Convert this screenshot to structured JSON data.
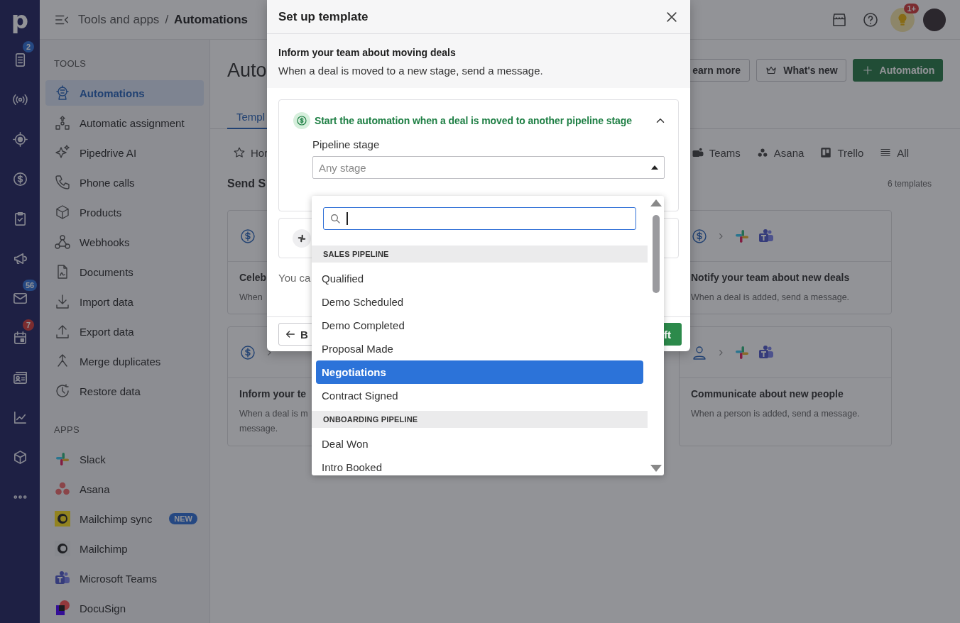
{
  "rail": {
    "logo": "p",
    "badges": [
      {
        "count": "2",
        "color": "#264882"
      },
      {
        "count": "56",
        "color": "#264882"
      },
      {
        "count": "7",
        "color": "#7b2d30"
      }
    ]
  },
  "topbar": {
    "parent": "Tools and apps",
    "separator": "/",
    "current": "Automations",
    "notification_badge": "1+"
  },
  "sidebar": {
    "sections": [
      {
        "title": "TOOLS",
        "items": [
          {
            "label": "Automations",
            "selected": true
          },
          {
            "label": "Automatic assignment",
            "selected": false
          },
          {
            "label": "Pipedrive AI",
            "selected": false
          },
          {
            "label": "Phone calls",
            "selected": false
          },
          {
            "label": "Products",
            "selected": false
          },
          {
            "label": "Webhooks",
            "selected": false
          },
          {
            "label": "Documents",
            "selected": false
          },
          {
            "label": "Import data",
            "selected": false
          },
          {
            "label": "Export data",
            "selected": false
          },
          {
            "label": "Merge duplicates",
            "selected": false
          },
          {
            "label": "Restore data",
            "selected": false
          }
        ]
      },
      {
        "title": "APPS",
        "items": [
          {
            "label": "Slack",
            "selected": false
          },
          {
            "label": "Asana",
            "selected": false
          },
          {
            "label": "Mailchimp sync",
            "selected": false,
            "badge": "NEW"
          },
          {
            "label": "Mailchimp",
            "selected": false
          },
          {
            "label": "Microsoft Teams",
            "selected": false
          },
          {
            "label": "DocuSign",
            "selected": false
          }
        ]
      }
    ]
  },
  "page": {
    "title": "Auto",
    "buttons": [
      {
        "label": "earn more",
        "kind": "outline"
      },
      {
        "label": "What's new",
        "kind": "crown"
      },
      {
        "label": "Automation",
        "kind": "primary"
      }
    ],
    "tabs": [
      {
        "label": "Templ",
        "selected": true
      }
    ],
    "filters_left": [
      "Hor"
    ],
    "filters_right": [
      "Teams",
      "Asana",
      "Trello",
      "All"
    ],
    "section_title": "Send S",
    "count": "6 templates",
    "cards": [
      {
        "kind": "template",
        "title": "Celeb",
        "description_lines": [
          "When"
        ]
      },
      {
        "kind": "template",
        "title": "Notify your team about new deals",
        "description_lines": [
          "When a deal is added, send a message."
        ]
      },
      {
        "kind": "template",
        "title": "Inform your te",
        "description_lines": [
          "When a deal is m",
          "message."
        ]
      },
      {
        "kind": "template",
        "title": "Communicate about new people",
        "description_lines": [
          "When a person is added, send a message."
        ]
      }
    ]
  },
  "modal": {
    "title": "Set up template",
    "heading": "Inform your team about moving deals",
    "description": "When a deal is moved to a new stage, send a message.",
    "trigger": {
      "title": "Start the automation when a deal is moved to another pipeline stage",
      "expanded": true
    },
    "field_label": "Pipeline stage",
    "select": {
      "placeholder": "Any stage",
      "open": true
    },
    "note": "You ca",
    "back": "B",
    "save": "ft"
  },
  "dropdown": {
    "groups": [
      {
        "title": "SALES PIPELINE",
        "items": [
          {
            "label": "Qualified",
            "selected": false
          },
          {
            "label": "Demo Scheduled",
            "selected": false
          },
          {
            "label": "Demo Completed",
            "selected": false
          },
          {
            "label": "Proposal Made",
            "selected": false
          },
          {
            "label": "Negotiations",
            "selected": true
          },
          {
            "label": "Contract Signed",
            "selected": false
          }
        ]
      },
      {
        "title": "ONBOARDING PIPELINE",
        "items": [
          {
            "label": "Deal Won",
            "selected": false
          },
          {
            "label": "Intro Booked",
            "selected": false
          }
        ]
      }
    ]
  }
}
